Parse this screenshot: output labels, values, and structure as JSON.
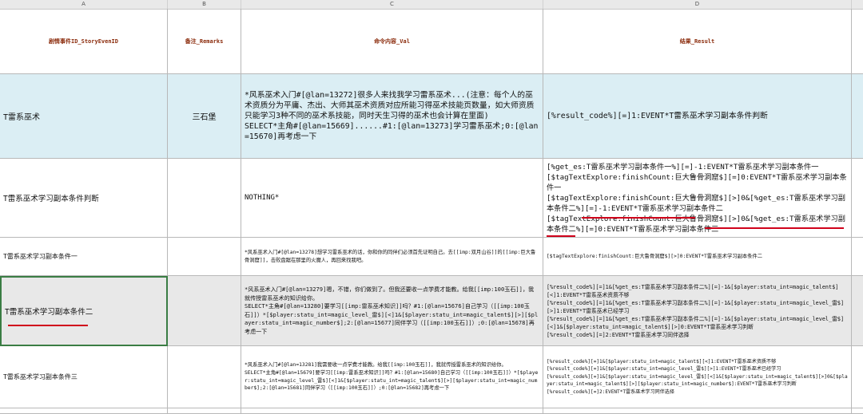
{
  "column_letters": [
    "A",
    "B",
    "C",
    "D"
  ],
  "headers": {
    "a": "剧情事件ID_StoryEvenID",
    "b": "备注_Remarks",
    "c": "命令内容_Val",
    "d": "结果_Result"
  },
  "rows": [
    {
      "a": "T雷系巫术",
      "b": "三石堡",
      "c": "*风系巫术入门#[@lan=13272]很多人来找我学习雷系巫术...(注意：每个人的巫术资质分为平庸、杰出、大师其巫术资质对应所能习得巫术技能页数量，如大师资质只能学习3种不同的巫术系技能，同时天生习得的巫术也会计算在里面)\nSELECT*主角#[@lan=15669]......#1:[@lan=13273]学习雷系巫术;0:[@lan=15670]再考虑一下",
      "d": "[%result_code%][=]1:EVENT*T雷系巫术学习副本条件判断"
    },
    {
      "a": "T雷系巫术学习副本条件判断",
      "b": "",
      "c": "NOTHING*",
      "d": "[%get_es:T雷系巫术学习副本条件一%][=]-1:EVENT*T雷系巫术学习副本条件一\n[$tagTextExplore:finishCount:巨大鲁骨洞窟$][=]0:EVENT*T雷系巫术学习副本条件一\n[$tagTextExplore:finishCount:巨大鲁骨洞窟$][>]0&[%get_es:T雷系巫术学习副本条件二%][=]-1:EVENT*T雷系巫术学习副本条件二\n[$tagTextExplore:finishCount:巨大鲁骨洞窟$][>]0&[%get_es:T雷系巫术学习副本条件二%][=]0:EVENT*T雷系巫术学习副本条件三"
    },
    {
      "a": "T雷系巫术学习副本条件一",
      "b": "",
      "c": "*风系巫术入门#[@lan=13278]想学习雷系巫术的话，你和你的同伴们必须首先证明自己。去[[imp:双月山谷]]的[[imp:巨大鲁骨洞窟]]，击败盘踞在那里的火魔人，再回来找我吧。",
      "d": "[$tagTextExplore:finishCount:巨大鲁骨洞窟$][>]0:EVENT*T雷系巫术学习副本条件二"
    },
    {
      "a": "T雷系巫术学习副本条件二",
      "b": "",
      "c": "*风系巫术入门#[@lan=13279]嗯，不错，你们做到了。但我还要收一点学费才能教。给我[[imp:100玉石]]，我就传授雷系巫术的知识给你。\nSELECT*主角#[@lan=13280]要学习[[imp:雷系巫术知识]]吗？#1:[@lan=15676]自己学习（[[imp:100玉石]]）*[$player:statu_int=magic_level_雷$][<]1&[$player:statu_int=magic_talent$][>][$player:statu_int=magic_number$];2:[@lan=15677]同伴学习（[[imp:100玉石]]）;0:[@lan=15678]再考虑一下",
      "d": "[%result_code%][=]1&[%get_es:T雷系巫术学习副本条件二%][=]-1&[$player:statu_int=magic_talent$][<]1:EVENT*T雷系巫术资质不够\n[%result_code%][=]1&[%get_es:T雷系巫术学习副本条件二%][=]-1&[$player:statu_int=magic_level_雷$][>]1:EVENT*T雷系巫术已经学习\n[%result_code%][=]1&[%get_es:T雷系巫术学习副本条件二%][=]-1&[$player:statu_int=magic_level_雷$][<]1&[$player:statu_int=magic_talent$][>]0:EVENT*T雷系巫术学习判断\n[%result_code%][=]2:EVENT*T雷系巫术学习同伴选择"
    },
    {
      "a": "T雷系巫术学习副本条件三",
      "b": "",
      "c": "*风系巫术入门#[@lan=13281]我需要收一点学费才能教。给我[[imp:100玉石]]，我就传授雷系巫术的知识给你。\nSELECT*主角#[@lan=15679]要学习[[imp:雷系巫术知识]]吗？#1:[@lan=15680]自己学习（[[imp:100玉石]]）*[$player:statu_int=magic_level_雷$][<]1&[$player:statu_int=magic_talent$][>][$player:statu_int=magic_number$];2:[@lan=15681]同伴学习（[[imp:100玉石]]）;0:[@lan=15682]再考虑一下",
      "d": "[%result_code%][=]1&[$player:statu_int=magic_talent$][<]1:EVENT*T雷系巫术资质不够\n[%result_code%][=]1&[$player:statu_int=magic_level_雷$][>]1:EVENT*T雷系巫术已经学习\n[%result_code%][=]1&[$player:statu_int=magic_level_雷$][<]1&[$player:statu_int=magic_talent$][>]0&[$player:statu_int=magic_talent$][>][$player:statu_int=magic_number$]:EVENT*T雷系巫术学习判断\n[%result_code%][=]2:EVENT*T雷系巫术学习同伴选择"
    }
  ],
  "colors": {
    "header_text": "#8a2a0a",
    "accent_row": "#dbeef4",
    "selected_border": "#3a7d44",
    "underline": "#d0021b"
  }
}
